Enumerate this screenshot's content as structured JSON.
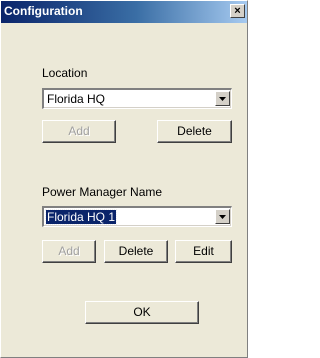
{
  "window": {
    "title": "Configuration",
    "close_glyph": "×"
  },
  "location": {
    "label": "Location",
    "selected_value": "Florida HQ",
    "add_label": "Add",
    "delete_label": "Delete"
  },
  "power_manager": {
    "label": "Power Manager Name",
    "selected_value": "Florida HQ 1",
    "add_label": "Add",
    "delete_label": "Delete",
    "edit_label": "Edit"
  },
  "footer": {
    "ok_label": "OK"
  },
  "icons": {
    "close": "close-icon",
    "dropdown": "chevron-down-icon"
  },
  "colors": {
    "titlebar_start": "#0a246a",
    "titlebar_end": "#a6caf0",
    "dialog_background": "#ece9d8",
    "selection": "#0a246a"
  }
}
